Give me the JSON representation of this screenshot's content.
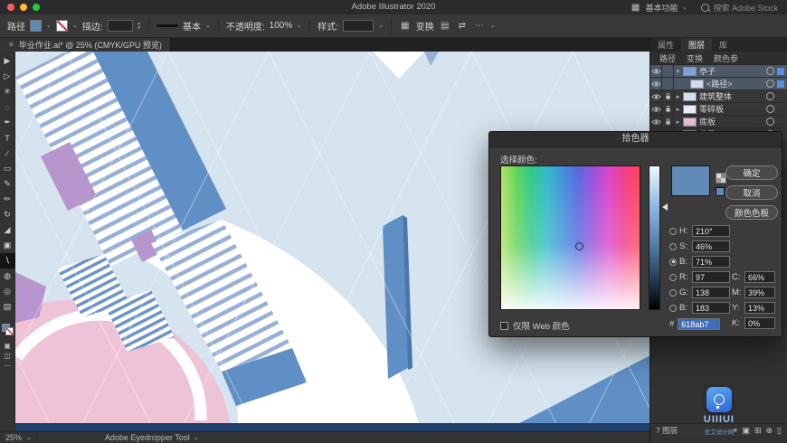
{
  "window": {
    "title": "Adobe Illustrator 2020"
  },
  "menubar": {
    "workspace_label": "基本功能",
    "search_placeholder": "搜索 Adobe Stock"
  },
  "icons": {
    "chevron_down": "⌄",
    "close": "✕",
    "workspace": "▦",
    "align": "▤",
    "flip": "⇄",
    "more": "⋯",
    "stepper_up": "▲",
    "stepper_down": "▼"
  },
  "control_bar": {
    "context_label": "路径",
    "fill_color": "#618ab7",
    "stroke_label": "描边:",
    "stroke_value": "",
    "brush_name": "基本",
    "opacity_label": "不透明度:",
    "opacity_value": "100%",
    "style_label": "样式:",
    "style_value": "",
    "transform_label": "变换"
  },
  "document_tab": {
    "title": "毕业作业.ai* @ 25% (CMYK/GPU 预览)"
  },
  "toolbar": {
    "tools": [
      {
        "name": "selection-tool",
        "glyph": "▶"
      },
      {
        "name": "direct-selection-tool",
        "glyph": "▷"
      },
      {
        "name": "magic-wand-tool",
        "glyph": "✳"
      },
      {
        "name": "lasso-tool",
        "glyph": "◌"
      },
      {
        "name": "pen-tool",
        "glyph": "✒"
      },
      {
        "name": "type-tool",
        "glyph": "T"
      },
      {
        "name": "line-segment-tool",
        "glyph": "∕"
      },
      {
        "name": "rectangle-tool",
        "glyph": "▭"
      },
      {
        "name": "paintbrush-tool",
        "glyph": "✎"
      },
      {
        "name": "pencil-tool",
        "glyph": "✏"
      },
      {
        "name": "rotate-tool",
        "glyph": "↻"
      },
      {
        "name": "scale-tool",
        "glyph": "◢"
      },
      {
        "name": "shape-builder-tool",
        "glyph": "▣"
      },
      {
        "name": "eyedropper-tool",
        "glyph": "∖",
        "selected": true
      },
      {
        "name": "gradient-tool",
        "glyph": "◍"
      },
      {
        "name": "zoom-tool",
        "glyph": "◎"
      },
      {
        "name": "hand-tool",
        "glyph": "▤"
      }
    ]
  },
  "canvas": {
    "colors": {
      "background": "#d5e4ef",
      "white": "#ffffff",
      "steel_blue": "#5f8fc5",
      "steel_blue_dark": "#4a77ab",
      "stripe_blue": "#97b0d8",
      "stripe_strong": "#6d94c9",
      "pink": "#eec3d8",
      "lavender": "#b795cd",
      "navy": "#20406b",
      "grid": "#ffffff"
    }
  },
  "color_picker": {
    "title": "拾色器",
    "select_color_label": "选择颜色:",
    "ok_label": "确定",
    "cancel_label": "取消",
    "swatches_label": "颜色色板",
    "current_color": "#618ab7",
    "hsb": [
      {
        "key": "h",
        "label": "H:",
        "value": "210°",
        "selected": false
      },
      {
        "key": "s",
        "label": "S:",
        "value": "46%",
        "selected": false
      },
      {
        "key": "b",
        "label": "B:",
        "value": "71%",
        "selected": true
      }
    ],
    "rgb": [
      {
        "key": "r",
        "label": "R:",
        "value": "97"
      },
      {
        "key": "g",
        "label": "G:",
        "value": "138"
      },
      {
        "key": "b2",
        "label": "B:",
        "value": "183"
      }
    ],
    "cmyk": [
      {
        "key": "c",
        "label": "C:",
        "value": "66%"
      },
      {
        "key": "m",
        "label": "M:",
        "value": "39%"
      },
      {
        "key": "y",
        "label": "Y:",
        "value": "13%"
      },
      {
        "key": "k",
        "label": "K:",
        "value": "0%"
      }
    ],
    "hex_label": "#",
    "hex_value": "618ab7",
    "web_only_label": "仅限 Web 颜色"
  },
  "right_panel": {
    "tabs": [
      {
        "label": "属性"
      },
      {
        "label": "图层"
      },
      {
        "label": "库"
      }
    ],
    "sub_tabs": [
      "路径",
      "变换",
      "颜色参"
    ],
    "layers": [
      {
        "name": "亭子",
        "selected": true,
        "locked": false,
        "disclosure": "▾",
        "indent": 0,
        "thumb": "#7fa3d4"
      },
      {
        "name": "<路径>",
        "selected": true,
        "locked": false,
        "disclosure": "",
        "indent": 1,
        "thumb": "#cfdcee"
      },
      {
        "name": "建筑整体",
        "selected": false,
        "locked": true,
        "disclosure": "▸",
        "indent": 0,
        "thumb": "#cfe0ee"
      },
      {
        "name": "零碎板",
        "selected": false,
        "locked": true,
        "disclosure": "▸",
        "indent": 0,
        "thumb": "#e8eef5"
      },
      {
        "name": "底板",
        "selected": false,
        "locked": true,
        "disclosure": "▸",
        "indent": 0,
        "thumb": "#ecc1d7"
      },
      {
        "name": "背景",
        "selected": false,
        "locked": true,
        "disclosure": "▸",
        "indent": 0,
        "thumb": "#bcd7ec"
      }
    ],
    "footer_label": "7 图层"
  },
  "status_bar": {
    "zoom": "25%",
    "tool_name": "Adobe Eyedropper Tool"
  },
  "watermark": {
    "title": "UIIIUI",
    "subtitle": "优艾设计网"
  }
}
